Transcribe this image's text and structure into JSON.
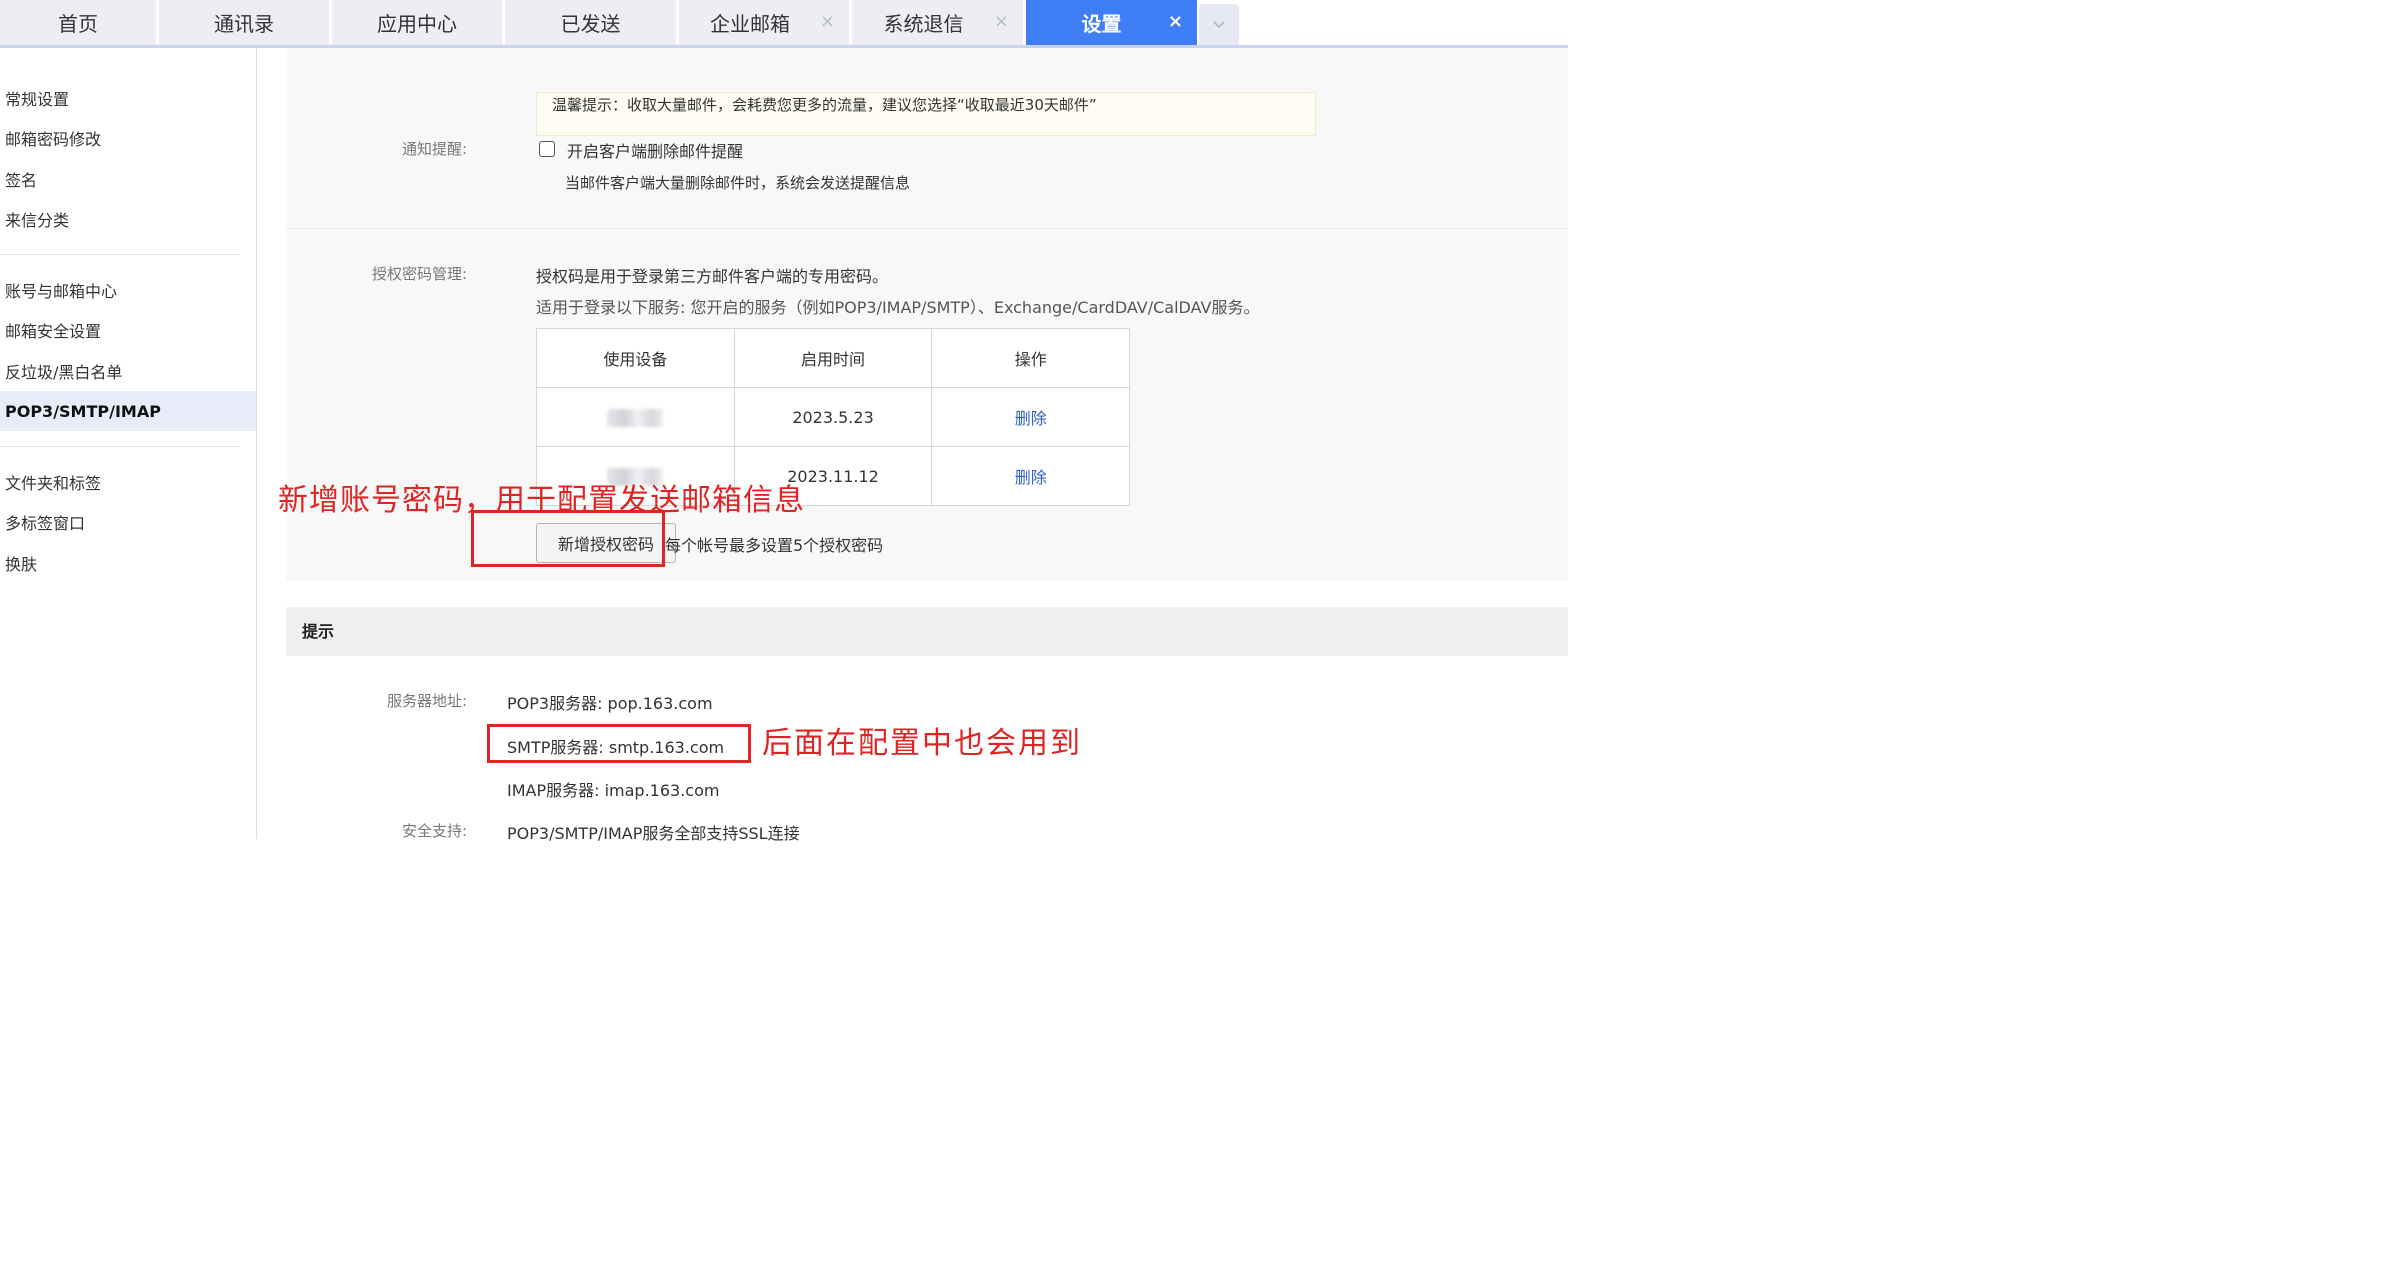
{
  "tabs": [
    {
      "label": "首页",
      "closable": false,
      "active": false
    },
    {
      "label": "通讯录",
      "closable": false,
      "active": false
    },
    {
      "label": "应用中心",
      "closable": false,
      "active": false
    },
    {
      "label": "已发送",
      "closable": false,
      "active": false
    },
    {
      "label": "企业邮箱",
      "closable": true,
      "active": false
    },
    {
      "label": "系统退信",
      "closable": true,
      "active": false
    },
    {
      "label": "设置",
      "closable": true,
      "active": true
    }
  ],
  "tab_close_glyph": "×",
  "sidebar": {
    "groups": [
      [
        "常规设置",
        "邮箱密码修改",
        "签名",
        "来信分类"
      ],
      [
        "账号与邮箱中心",
        "邮箱安全设置",
        "反垃圾/黑白名单",
        "POP3/SMTP/IMAP"
      ],
      [
        "文件夹和标签",
        "多标签窗口",
        "换肤"
      ]
    ],
    "active_item": "POP3/SMTP/IMAP"
  },
  "main": {
    "tip": "温馨提示：收取大量邮件，会耗费您更多的流量，建议您选择“收取最近30天邮件”",
    "notify": {
      "label": "通知提醒:",
      "checkbox_label": "开启客户端删除邮件提醒",
      "checked": false,
      "desc": "当邮件客户端大量删除邮件时，系统会发送提醒信息"
    },
    "auth": {
      "label": "授权密码管理:",
      "desc1": "授权码是用于登录第三方邮件客户端的专用密码。",
      "desc2": "适用于登录以下服务: 您开启的服务（例如POP3/IMAP/SMTP）、Exchange/CardDAV/CalDAV服务。",
      "table_headers": [
        "使用设备",
        "启用时间",
        "操作"
      ],
      "rows": [
        {
          "time": "2023.5.23",
          "action": "删除"
        },
        {
          "time": "2023.11.12",
          "action": "删除"
        }
      ],
      "add_button": "新增授权密码",
      "limit_note": "每个帐号最多设置5个授权密码"
    },
    "hints": {
      "header": "提示",
      "server_label": "服务器地址:",
      "pop3": "POP3服务器: pop.163.com",
      "smtp": "SMTP服务器: smtp.163.com",
      "imap": "IMAP服务器: imap.163.com",
      "security_label": "安全支持:",
      "security_value": "POP3/SMTP/IMAP服务全部支持SSL连接"
    }
  },
  "annotations": {
    "add_password": "新增账号密码，用于配置发送邮箱信息",
    "smtp_note": "后面在配置中也会用到",
    "color": "#e02323"
  },
  "colors": {
    "active_tab": "#3f7ef5",
    "link": "#2f5fc9",
    "active_sidebar_bg": "#e7ecf8"
  }
}
